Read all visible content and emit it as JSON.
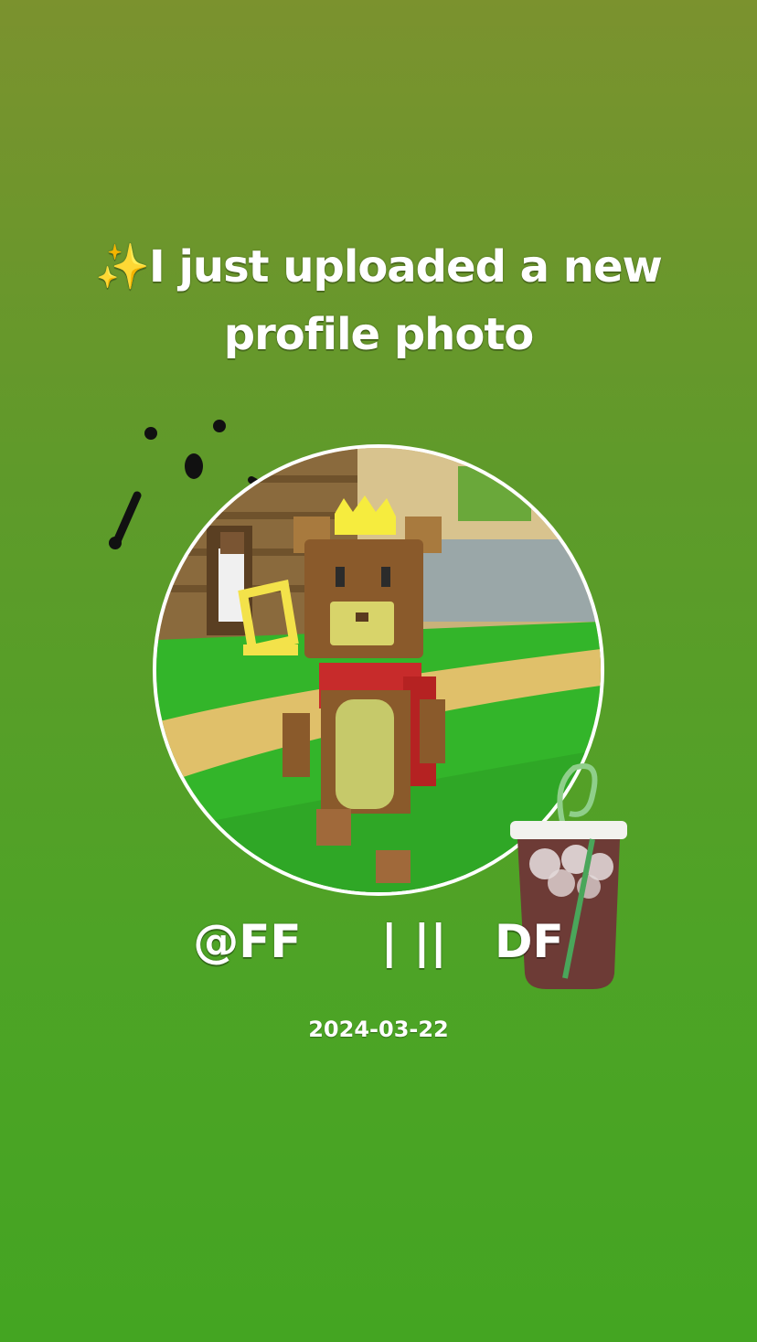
{
  "headline": {
    "sparkle": "✨",
    "text": "I just uploaded a new profile photo"
  },
  "profile": {
    "handle": "@FF     | ||   DF",
    "date": "2024-03-22"
  },
  "stickers": {
    "doodle": "surprised-face-doodle-icon",
    "drink": "iced-coffee-sticker-icon"
  },
  "colors": {
    "background_top": "#7b922e",
    "background_bottom": "#44a522",
    "text": "#ffffff",
    "ring": "#ffffff"
  }
}
